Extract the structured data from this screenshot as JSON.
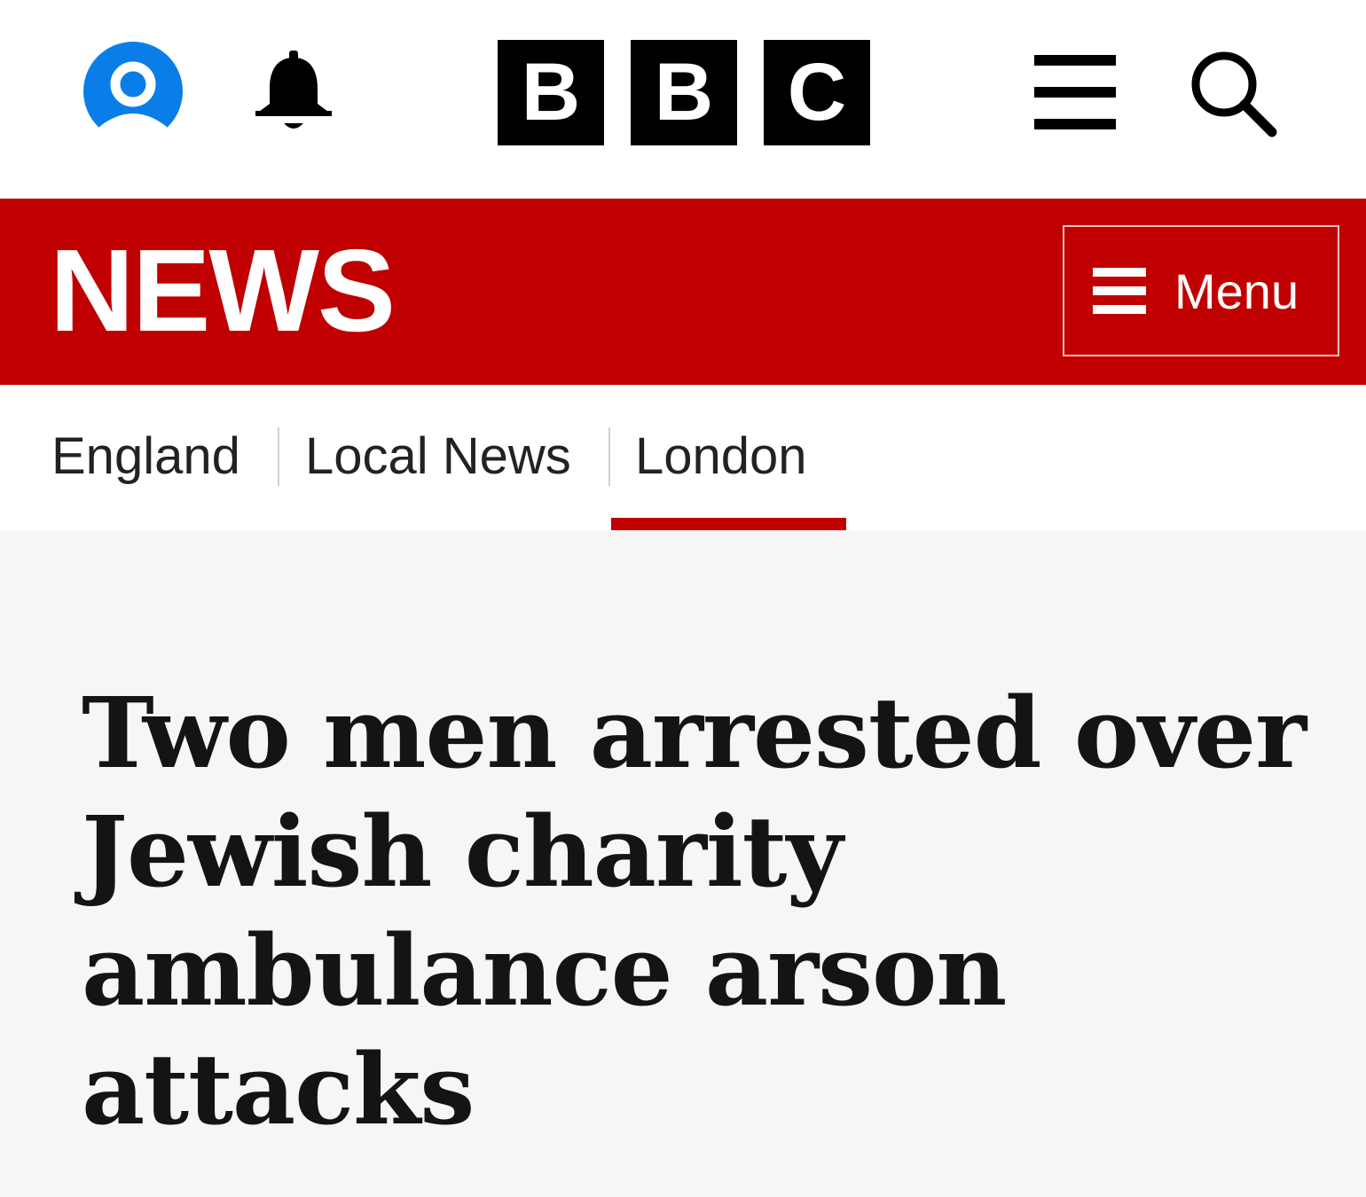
{
  "header": {
    "brand_letters": [
      "B",
      "B",
      "C"
    ],
    "icons": {
      "account": "account-icon",
      "notifications": "bell-icon",
      "menu": "hamburger-icon",
      "search": "search-icon"
    },
    "colors": {
      "account_blue": "#0a7ee8",
      "logo_black": "#000000"
    }
  },
  "news_bar": {
    "wordmark": "NEWS",
    "menu_label": "Menu",
    "menu_icon": "hamburger-icon",
    "color": "#c00000"
  },
  "section_nav": {
    "items": [
      {
        "label": "England",
        "active": false
      },
      {
        "label": "Local News",
        "active": false
      },
      {
        "label": "London",
        "active": true
      }
    ],
    "active_color": "#c00000"
  },
  "article": {
    "headline": "Two men arrested over Jewish charity ambulance arson attacks"
  }
}
